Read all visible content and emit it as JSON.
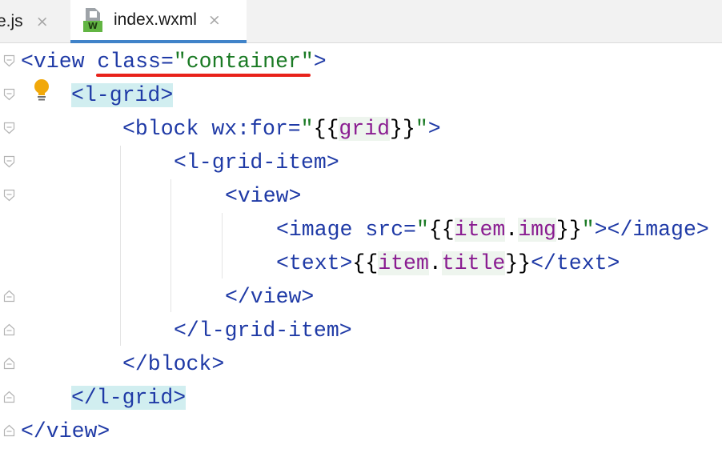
{
  "tabs": [
    {
      "label": "e.js",
      "active": false,
      "close_icon": "×"
    },
    {
      "label": "index.wxml",
      "active": true,
      "close_icon": "×",
      "file_badge": "W"
    }
  ],
  "code": {
    "line1": {
      "open": "<view",
      "attr": "class",
      "eq": "=",
      "q1": "\"",
      "value": "container",
      "q2": "\"",
      "close": ">"
    },
    "line2": {
      "tag": "<l-grid>"
    },
    "line3": {
      "open": "<block",
      "attr": "wx:for",
      "eq": "=",
      "q1": "\"",
      "b1": "{{",
      "expr": "grid",
      "b2": "}}",
      "q2": "\"",
      "close": ">"
    },
    "line4": {
      "tag": "<l-grid-item>"
    },
    "line5": {
      "tag": "<view>"
    },
    "line6": {
      "open": "<image",
      "attr": "src",
      "eq": "=",
      "q1": "\"",
      "b1": "{{",
      "expr1": "item",
      "dot": ".",
      "expr2": "img",
      "b2": "}}",
      "q2": "\"",
      "close": "></image>"
    },
    "line7": {
      "open": "<text>",
      "b1": "{{",
      "expr1": "item",
      "dot": ".",
      "expr2": "title",
      "b2": "}}",
      "close": "</text>"
    },
    "line8": {
      "tag": "</view>"
    },
    "line9": {
      "tag": "</l-grid-item>"
    },
    "line10": {
      "tag": "</block>"
    },
    "line11": {
      "tag": "</l-grid>"
    },
    "line12": {
      "tag": "</view>"
    }
  },
  "icons": {
    "intention_bulb": "lightbulb-icon",
    "fold_markers": "fold-marker-icon"
  },
  "colors": {
    "tag": "#1f3aa6",
    "string": "#1a7a24",
    "expression": "#8a1d91",
    "tag_highlight": "#d1eef0",
    "underline": "#e8221b",
    "active_tab_border": "#4083c9"
  }
}
